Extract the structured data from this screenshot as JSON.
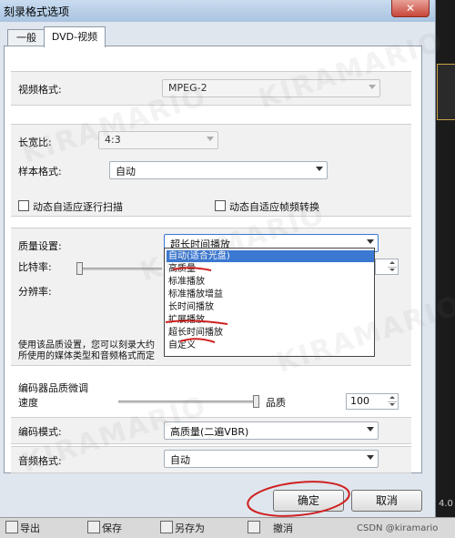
{
  "window": {
    "title": "刻录格式选项",
    "close_glyph": "✕"
  },
  "tabs": [
    {
      "label": "一般"
    },
    {
      "label": "DVD-视频"
    }
  ],
  "video_format": {
    "label": "视频格式:",
    "value": "MPEG-2"
  },
  "aspect_ratio": {
    "label": "长宽比:",
    "value": "4:3"
  },
  "sample_format": {
    "label": "样本格式:",
    "value": "自动"
  },
  "checkboxes": [
    {
      "label": "动态自适应逐行扫描",
      "checked": false
    },
    {
      "label": "动态自适应帧频转换",
      "checked": false
    }
  ],
  "quality": {
    "label": "质量设置:",
    "value": "超长时间播放",
    "bitrate_label": "比特率:",
    "resolution_label": "分辨率:",
    "options": [
      "自动(适合光盘)",
      "高质量",
      "标准播放",
      "标准播放增益",
      "长时间播放",
      "扩展播放",
      "超长时间播放",
      "自定义"
    ],
    "selected_index": 0
  },
  "description": {
    "line1": "使用该品质设置，您可以刻录大约",
    "line2": "所使用的媒体类型和音频格式而定"
  },
  "encoder_tuning": {
    "label": "编码器品质微调",
    "speed_label": "速度",
    "quality_label": "品质",
    "value": "100"
  },
  "encoding_mode": {
    "label": "编码模式:",
    "value": "高质量(二遍VBR)"
  },
  "audio_format": {
    "label": "音频格式:",
    "value": "自动"
  },
  "buttons": {
    "ok": "确定",
    "cancel": "取消"
  },
  "taskbar": {
    "items": [
      "导出",
      "保存",
      "另存为",
      "撤消"
    ]
  },
  "desktop": {
    "version": "4.0"
  },
  "watermark": {
    "csdn": "CSDN @kiramario",
    "text": "KIRAMARIO"
  }
}
